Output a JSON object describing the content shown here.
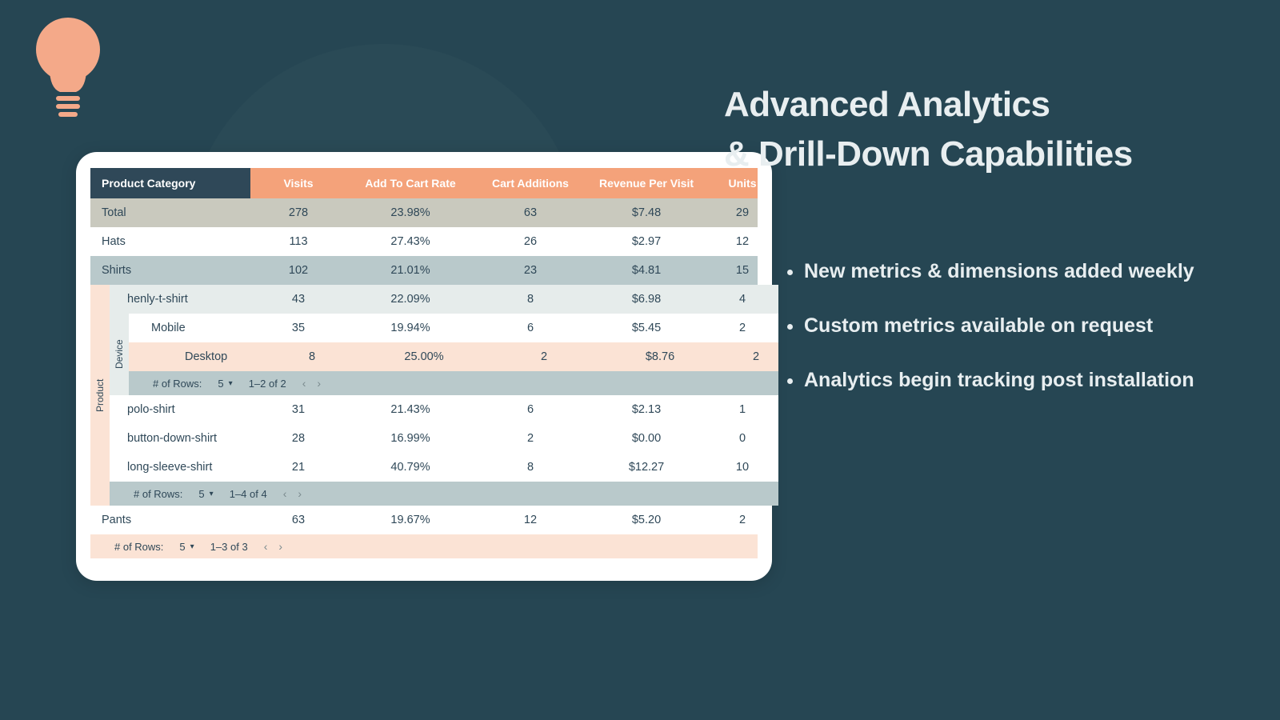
{
  "heading": {
    "line1": "Advanced Analytics",
    "line2": "& Drill-Down Capabilities"
  },
  "bullets": [
    "New metrics & dimensions added weekly",
    "Custom metrics available on request",
    "Analytics begin tracking post installation"
  ],
  "table": {
    "headers": [
      "Product Category",
      "Visits",
      "Add To Cart Rate",
      "Cart Additions",
      "Revenue Per Visit",
      "Units"
    ],
    "total": {
      "label": "Total",
      "visits": "278",
      "atc": "23.98%",
      "adds": "63",
      "rpv": "$7.48",
      "units": "29"
    },
    "hats": {
      "label": "Hats",
      "visits": "113",
      "atc": "27.43%",
      "adds": "26",
      "rpv": "$2.97",
      "units": "12"
    },
    "shirts": {
      "label": "Shirts",
      "visits": "102",
      "atc": "21.01%",
      "adds": "23",
      "rpv": "$4.81",
      "units": "15"
    },
    "pants": {
      "label": "Pants",
      "visits": "63",
      "atc": "19.67%",
      "adds": "12",
      "rpv": "$5.20",
      "units": "2"
    },
    "nest_labels": {
      "product": "Product",
      "device": "Device"
    },
    "products": {
      "henly": {
        "label": "henly-t-shirt",
        "visits": "43",
        "atc": "22.09%",
        "adds": "8",
        "rpv": "$6.98",
        "units": "4"
      },
      "polo": {
        "label": "polo-shirt",
        "visits": "31",
        "atc": "21.43%",
        "adds": "6",
        "rpv": "$2.13",
        "units": "1"
      },
      "button": {
        "label": "button-down-shirt",
        "visits": "28",
        "atc": "16.99%",
        "adds": "2",
        "rpv": "$0.00",
        "units": "0"
      },
      "long": {
        "label": "long-sleeve-shirt",
        "visits": "21",
        "atc": "40.79%",
        "adds": "8",
        "rpv": "$12.27",
        "units": "10"
      }
    },
    "devices": {
      "mobile": {
        "label": "Mobile",
        "visits": "35",
        "atc": "19.94%",
        "adds": "6",
        "rpv": "$5.45",
        "units": "2"
      },
      "desktop": {
        "label": "Desktop",
        "visits": "8",
        "atc": "25.00%",
        "adds": "2",
        "rpv": "$8.76",
        "units": "2"
      }
    },
    "pager": {
      "rows_label": "# of Rows:",
      "rows_value": "5",
      "range_device": "1–2 of 2",
      "range_product": "1–4 of 4",
      "range_top": "1–3 of 3"
    }
  }
}
